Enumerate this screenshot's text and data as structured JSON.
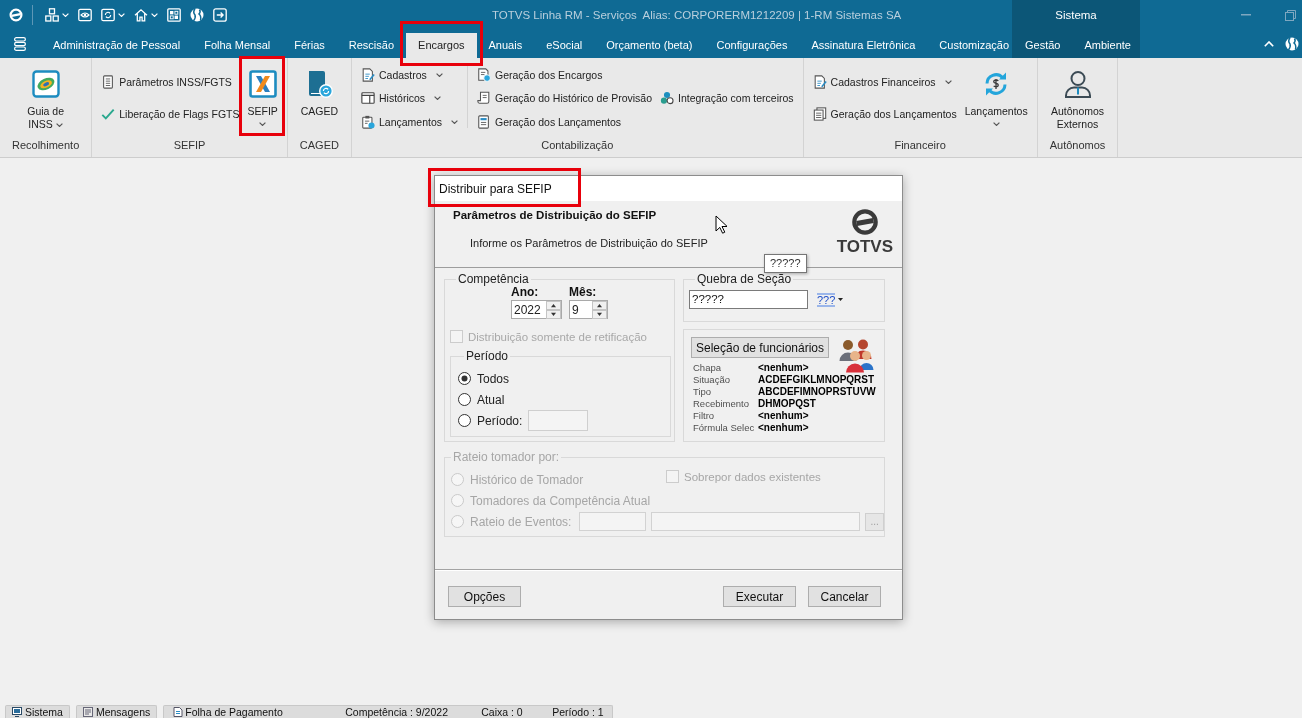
{
  "window": {
    "title": "TOTVS Linha RM - Serviços  Alias: CORPORERM1212209 | 1-RM Sistemas SA",
    "context_group": "Sistema"
  },
  "quick_access": [
    {
      "dropdown": false
    },
    {
      "dropdown": true
    },
    {
      "dropdown": false
    },
    {
      "dropdown": true
    },
    {
      "dropdown": true
    },
    {
      "dropdown": false
    },
    {
      "dropdown": false
    },
    {
      "dropdown": false
    }
  ],
  "tabs": [
    {
      "label": "Administração de Pessoal",
      "kind": "main",
      "selected": false,
      "highlighted": false
    },
    {
      "label": "Folha Mensal",
      "kind": "main",
      "selected": false,
      "highlighted": false
    },
    {
      "label": "Férias",
      "kind": "main",
      "selected": false,
      "highlighted": false
    },
    {
      "label": "Rescisão",
      "kind": "main",
      "selected": false,
      "highlighted": false
    },
    {
      "label": "Encargos",
      "kind": "main",
      "selected": true,
      "highlighted": true
    },
    {
      "label": "Anuais",
      "kind": "main",
      "selected": false,
      "highlighted": false
    },
    {
      "label": "eSocial",
      "kind": "main",
      "selected": false,
      "highlighted": false
    },
    {
      "label": "Orçamento (beta)",
      "kind": "main",
      "selected": false,
      "highlighted": false
    },
    {
      "label": "Configurações",
      "kind": "main",
      "selected": false,
      "highlighted": false
    },
    {
      "label": "Assinatura Eletrônica",
      "kind": "main",
      "selected": false,
      "highlighted": false
    },
    {
      "label": "Customização",
      "kind": "main",
      "selected": false,
      "highlighted": false
    },
    {
      "label": "Gestão",
      "kind": "context",
      "selected": false,
      "highlighted": false
    },
    {
      "label": "Ambiente",
      "kind": "context",
      "selected": false,
      "highlighted": false
    }
  ],
  "ribbon_groups": [
    {
      "label": "Recolhimento",
      "columns": [
        {
          "kind": "large",
          "label": "Guia de INSS",
          "dropdown": true,
          "highlighted": false
        }
      ]
    },
    {
      "label": "SEFIP",
      "columns": [
        {
          "kind": "stack",
          "items": [
            {
              "label": "Parâmetros INSS/FGTS",
              "dropdown": false
            },
            {
              "label": "Liberação de Flags FGTS",
              "dropdown": false
            }
          ]
        },
        {
          "kind": "large",
          "label": "SEFIP",
          "dropdown": true,
          "highlighted": true
        }
      ]
    },
    {
      "label": "CAGED",
      "columns": [
        {
          "kind": "large",
          "label": "CAGED",
          "dropdown": false,
          "highlighted": false
        }
      ]
    },
    {
      "label": "Contabilização",
      "columns": [
        {
          "kind": "stack",
          "items": [
            {
              "label": "Cadastros",
              "dropdown": true
            },
            {
              "label": "Históricos",
              "dropdown": true
            },
            {
              "label": "Lançamentos",
              "dropdown": true
            }
          ]
        },
        {
          "kind": "separator"
        },
        {
          "kind": "stack",
          "items": [
            {
              "label": "Geração dos Encargos",
              "dropdown": false
            },
            {
              "label": "Geração do Histórico de Provisão",
              "dropdown": false
            },
            {
              "label": "Geração dos Lançamentos",
              "dropdown": false
            }
          ]
        },
        {
          "kind": "stack",
          "items": [
            {
              "label": "Integração com terceiros",
              "dropdown": false
            }
          ]
        }
      ]
    },
    {
      "label": "Financeiro",
      "columns": [
        {
          "kind": "stack",
          "items": [
            {
              "label": "Cadastros Financeiros",
              "dropdown": true
            },
            {
              "label": "Geração dos Lançamentos",
              "dropdown": false
            }
          ]
        },
        {
          "kind": "large",
          "label": "Lançamentos",
          "dropdown": true,
          "highlighted": false
        }
      ]
    },
    {
      "label": "Autônomos",
      "columns": [
        {
          "kind": "large",
          "label": "Autônomos Externos",
          "dropdown": false,
          "highlighted": false
        }
      ]
    }
  ],
  "dialog": {
    "title": "Distribuir para SEFIP",
    "title_highlighted": true,
    "heading": "Parâmetros de Distribuição do SEFIP",
    "subheading": "Informe os Parâmetros de Distribuição do SEFIP",
    "logo": "TOTVS",
    "tooltip": "?????",
    "competencia": {
      "title": "Competência",
      "year_label": "Ano:",
      "year": "2022",
      "month_label": "Mês:",
      "month": "9",
      "retification": {
        "label": "Distribuição somente de retificação",
        "checked": false,
        "disabled": true
      },
      "period_group": {
        "title": "Período",
        "options": [
          {
            "label": "Todos",
            "kind": "plain",
            "selected": true
          },
          {
            "label": "Atual",
            "kind": "plain",
            "selected": false
          },
          {
            "label": "Período:",
            "kind": "with_field",
            "selected": false
          }
        ]
      }
    },
    "section_break": {
      "title": "Quebra de Seção",
      "value": "?????",
      "picker": "???"
    },
    "employee_selection": {
      "button": "Seleção de funcionários",
      "fields": [
        {
          "label": "Chapa",
          "value": "<nenhum>"
        },
        {
          "label": "Situação",
          "value": "ACDEFGIKLMNOPQRST"
        },
        {
          "label": "Tipo",
          "value": "ABCDEFIMNOPRSTUVW"
        },
        {
          "label": "Recebimento",
          "value": "DHMOPQST"
        },
        {
          "label": "Filtro",
          "value": "<nenhum>"
        },
        {
          "label": "Fórmula Selec",
          "value": "<nenhum>"
        }
      ]
    },
    "apportionment": {
      "title": "Rateio tomador por:",
      "disabled": true,
      "options": [
        {
          "label": "Histórico de Tomador",
          "kind": "plain",
          "selected": false
        },
        {
          "label": "Tomadores da Competência Atual",
          "kind": "plain",
          "selected": false
        },
        {
          "label": "Rateio de Eventos:",
          "kind": "with_fields",
          "selected": false
        }
      ],
      "overwrite": {
        "label": "Sobrepor dados existentes",
        "checked": false
      },
      "browse_button": "..."
    },
    "buttons": [
      {
        "label": "Opções",
        "kind": "left"
      },
      {
        "label": "Executar",
        "kind": "right"
      },
      {
        "label": "Cancelar",
        "kind": "right"
      }
    ]
  },
  "status_bar": {
    "tabs": [
      {
        "label": "Sistema"
      },
      {
        "label": "Mensagens"
      }
    ],
    "info": [
      "Folha de Pagamento",
      "Competência : 9/2022",
      "Caixa : 0",
      "Período : 1"
    ]
  }
}
